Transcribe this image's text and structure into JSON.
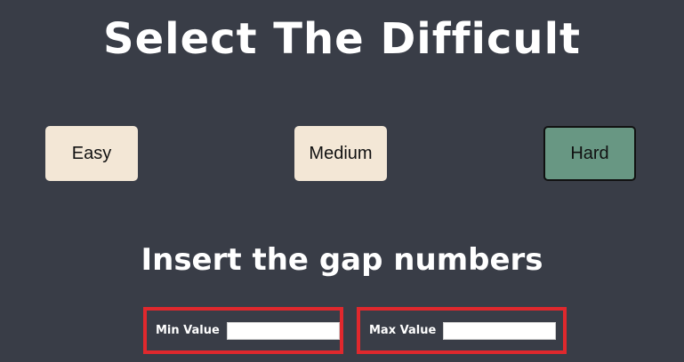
{
  "header": {
    "title": "Select The Difficult"
  },
  "difficulty": {
    "options": [
      {
        "label": "Easy"
      },
      {
        "label": "Medium"
      },
      {
        "label": "Hard"
      }
    ],
    "selected": "Hard"
  },
  "range": {
    "subtitle": "Insert the gap numbers",
    "min_label": "Min Value",
    "min_value": "",
    "max_label": "Max Value",
    "max_value": ""
  },
  "colors": {
    "background": "#393d47",
    "button_default": "#f3e7d6",
    "button_selected": "#689783",
    "highlight_border": "#e0282d"
  }
}
